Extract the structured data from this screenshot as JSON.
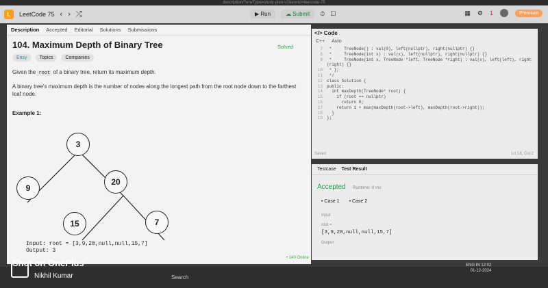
{
  "browser": {
    "url_fragment": "description/?envType=study-plan-v2&envId=leetcode-75"
  },
  "topbar": {
    "title": "LeetCode 75",
    "run": "Run",
    "submit": "Submit",
    "premium": "Premium",
    "notif_count": "1"
  },
  "tabs": [
    {
      "label": "Description"
    },
    {
      "label": "Accepted"
    },
    {
      "label": "Editorial"
    },
    {
      "label": "Solutions"
    },
    {
      "label": "Submissions"
    }
  ],
  "problem": {
    "title": "104. Maximum Depth of Binary Tree",
    "status": "Solved",
    "difficulty": "Easy",
    "topics": "Topics",
    "companies": "Companies",
    "desc1_pre": "Given the",
    "desc1_code": "root",
    "desc1_post": "of a binary tree, return its maximum depth.",
    "desc2": "A binary tree's maximum depth is the number of nodes along the longest path from the root node down to the farthest leaf node.",
    "example_title": "Example 1:",
    "tree_nodes": [
      "3",
      "9",
      "20",
      "15",
      "7"
    ],
    "input": "Input: root = [3,9,20,null,null,15,7]",
    "output": "Output: 3",
    "online": "• 140 Online"
  },
  "code_panel": {
    "header": "</> Code",
    "language": "C++",
    "auto": "Auto",
    "lines": [
      {
        "n": "7",
        "t": " *     TreeNode() : val(0), left(nullptr), right(nullptr) {}"
      },
      {
        "n": "8",
        "t": " *     TreeNode(int x) : val(x), left(nullptr), right(nullptr) {}"
      },
      {
        "n": "9",
        "t": " *     TreeNode(int x, TreeNode *left, TreeNode *right) : val(x), left(left), right"
      },
      {
        "n": "",
        "t": "(right) {}"
      },
      {
        "n": "10",
        "t": " * };"
      },
      {
        "n": "11",
        "t": " */"
      },
      {
        "n": "12",
        "t": "class Solution {"
      },
      {
        "n": "13",
        "t": "public:"
      },
      {
        "n": "14",
        "t": "  int maxDepth(TreeNode* root) {"
      },
      {
        "n": "15",
        "t": "    if (root == nullptr)"
      },
      {
        "n": "16",
        "t": "      return 0;"
      },
      {
        "n": "17",
        "t": "    return 1 + max(maxDepth(root->left), maxDepth(root->right));"
      },
      {
        "n": "18",
        "t": "  }"
      },
      {
        "n": "19",
        "t": "};"
      }
    ],
    "saved": "Saved",
    "position": "Ln 18, Col 2"
  },
  "test_panel": {
    "tab_testcase": "Testcase",
    "tab_result": "Test Result",
    "accepted": "Accepted",
    "runtime": "Runtime: 0 ms",
    "case1": "• Case 1",
    "case2": "• Case 2",
    "input_label": "Input",
    "root_label": "root =",
    "root_value": "[3,9,20,null,null,15,7]",
    "output_label": "Output"
  },
  "overlay": {
    "brand": "Shot on OnePlus",
    "author": "Nikhil Kumar"
  },
  "taskbar": {
    "search": "Search",
    "lang": "ENG",
    "region": "IN",
    "time": "12:02",
    "date": "01-12-2024"
  }
}
